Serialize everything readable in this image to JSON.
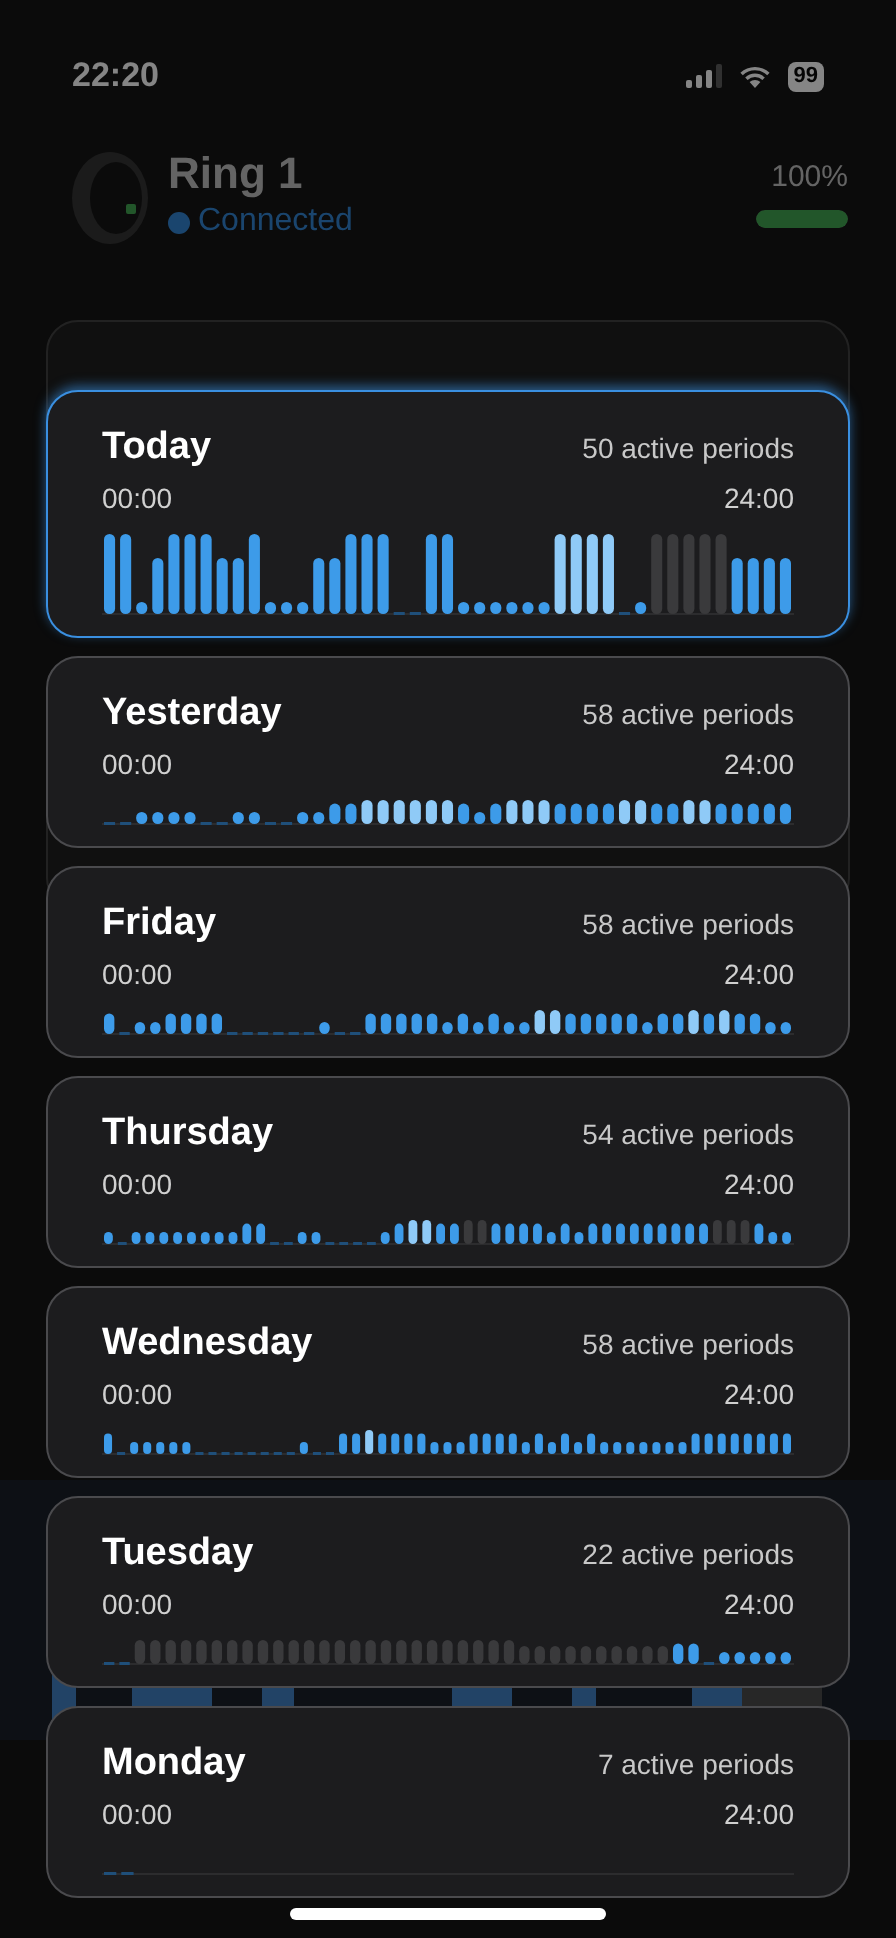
{
  "status_bar": {
    "time": "22:20",
    "battery": "99"
  },
  "device": {
    "name": "Ring 1",
    "status": "Connected",
    "battery_percent": "100%",
    "battery": {
      "level": 1.0
    }
  },
  "days": [
    {
      "label": "Today",
      "periods": "50 active periods",
      "start": "00:00",
      "end": "24:00",
      "selected": true
    },
    {
      "label": "Yesterday",
      "periods": "58 active periods",
      "start": "00:00",
      "end": "24:00",
      "selected": false
    },
    {
      "label": "Friday",
      "periods": "58 active periods",
      "start": "00:00",
      "end": "24:00",
      "selected": false
    },
    {
      "label": "Thursday",
      "periods": "54 active periods",
      "start": "00:00",
      "end": "24:00",
      "selected": false
    },
    {
      "label": "Wednesday",
      "periods": "58 active periods",
      "start": "00:00",
      "end": "24:00",
      "selected": false
    },
    {
      "label": "Tuesday",
      "periods": "22 active periods",
      "start": "00:00",
      "end": "24:00",
      "selected": false
    },
    {
      "label": "Monday",
      "periods": "7 active periods",
      "start": "00:00",
      "end": "24:00",
      "selected": false
    }
  ]
}
